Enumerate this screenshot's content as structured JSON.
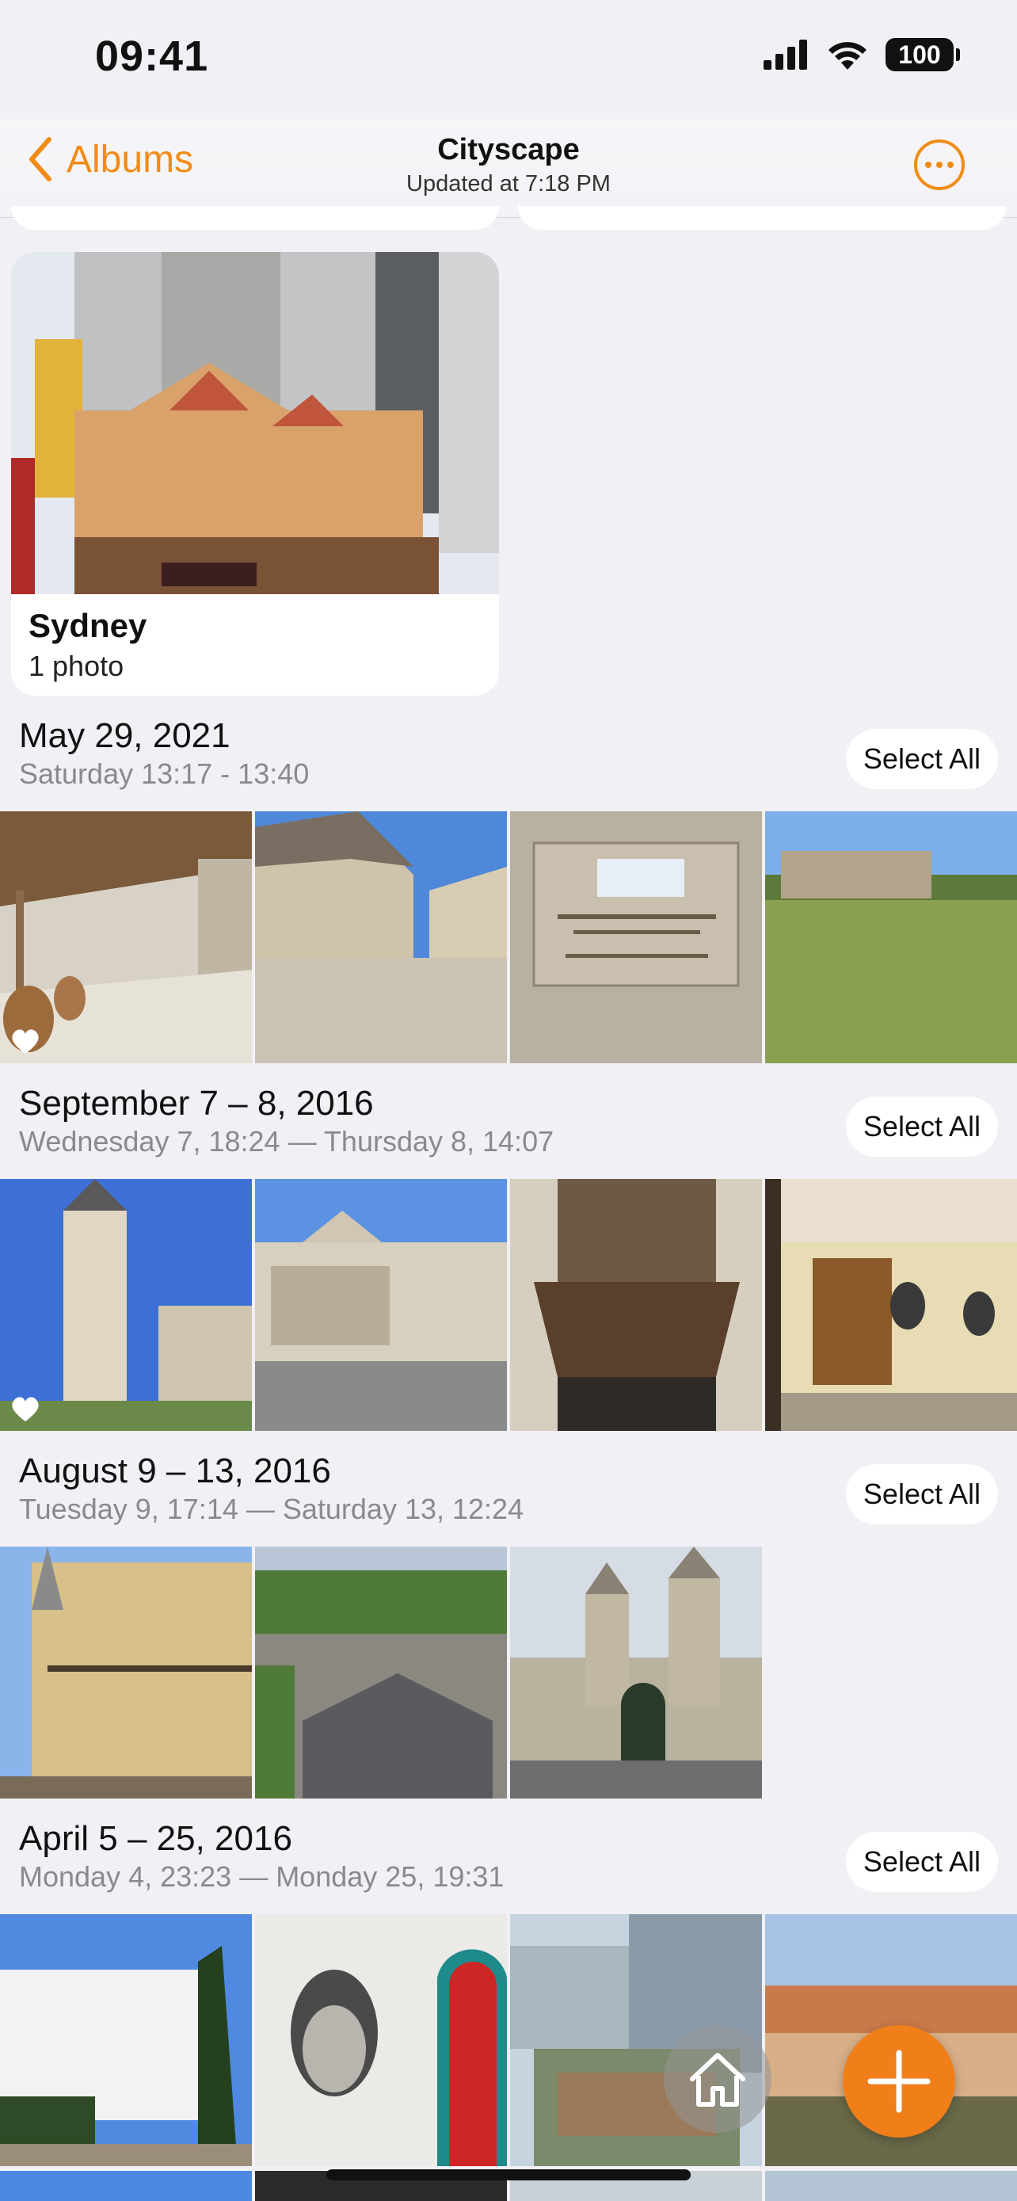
{
  "status_bar": {
    "time": "09:41",
    "battery": "100"
  },
  "nav": {
    "back_label": "Albums",
    "title": "Cityscape",
    "subtitle": "Updated at 7:18 PM"
  },
  "album": {
    "name": "Sydney",
    "count": "1 photo"
  },
  "sections": [
    {
      "title": "May 29, 2021",
      "subtitle": "Saturday 13:17 - 13:40",
      "select_label": "Select All"
    },
    {
      "title": "September 7 – 8, 2016",
      "subtitle": "Wednesday 7, 18:24 — Thursday 8, 14:07",
      "select_label": "Select All"
    },
    {
      "title": "August 9 – 13, 2016",
      "subtitle": "Tuesday 9, 17:14 — Saturday 13, 12:24",
      "select_label": "Select All"
    },
    {
      "title": "April 5 – 25, 2016",
      "subtitle": "Monday 4, 23:23 — Monday 25, 19:31",
      "select_label": "Select All"
    }
  ],
  "colors": {
    "accent": "#f08c16",
    "fab": "#f07f1a",
    "background": "#f1f0f5"
  },
  "icons": [
    "cellular-icon",
    "wifi-icon",
    "battery-icon",
    "chevron-left-icon",
    "ellipsis-circle-icon",
    "heart-icon",
    "home-icon",
    "plus-icon"
  ]
}
